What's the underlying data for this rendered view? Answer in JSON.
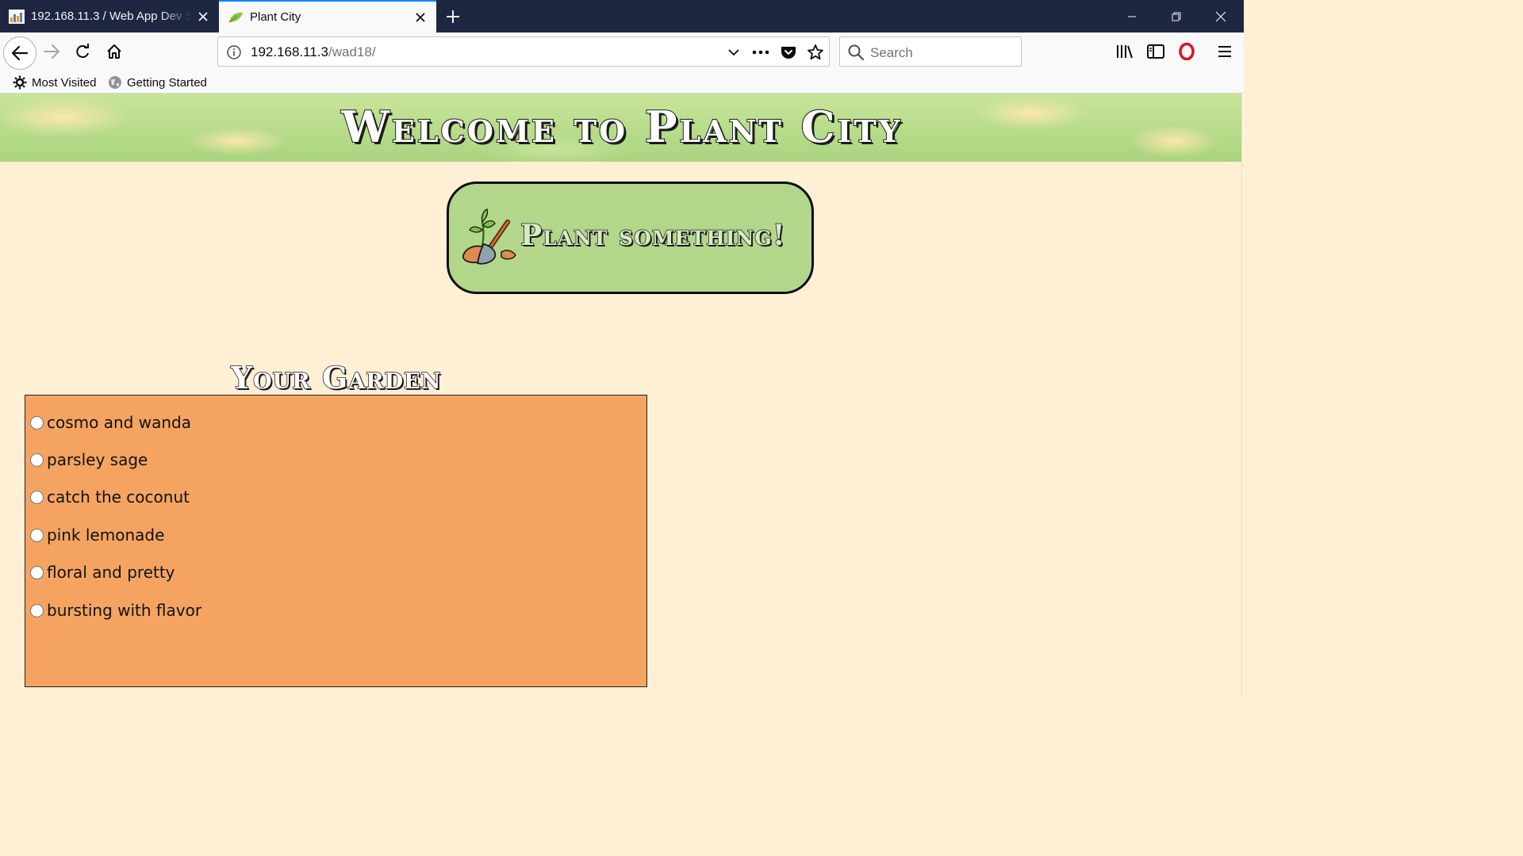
{
  "browser": {
    "tabs": [
      {
        "title": "192.168.11.3 / Web App Dev Se",
        "active": false
      },
      {
        "title": "Plant City",
        "active": true
      }
    ],
    "url_host": "192.168.11.3",
    "url_path": "/wad18/",
    "search_placeholder": "Search",
    "bookmarks": [
      "Most Visited",
      "Getting Started"
    ]
  },
  "page": {
    "banner_title": "Welcome to Plant City",
    "plant_button_label": "Plant something!",
    "garden_title": "Your Garden",
    "garden_items": [
      "cosmo and wanda",
      "parsley sage",
      "catch the coconut",
      "pink lemonade",
      "floral and pretty",
      "bursting with flavor"
    ]
  },
  "colors": {
    "page_background": "#ffefd5",
    "banner_green": "#b7dc8a",
    "button_green": "#b2d78a",
    "garden_box": "#f4a460",
    "tabstrip": "#1f2641",
    "accent": "#0a84ff"
  }
}
